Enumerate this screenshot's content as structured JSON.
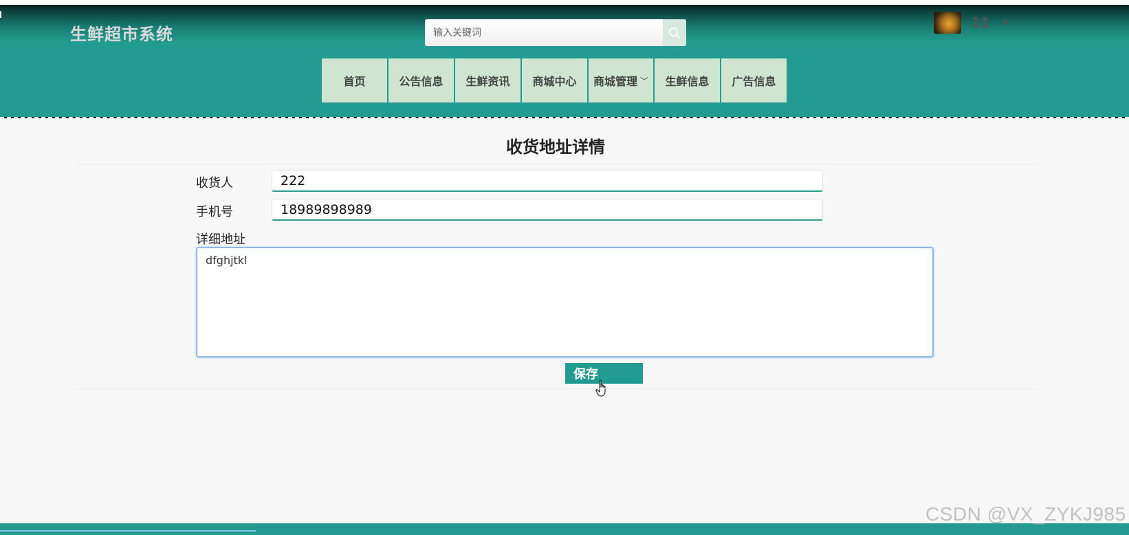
{
  "header": {
    "logo_text": "生鲜超市系统",
    "search": {
      "placeholder": "输入关键词",
      "value": ""
    },
    "user": {
      "name": "11"
    }
  },
  "nav": {
    "items": [
      {
        "label": "首页"
      },
      {
        "label": "公告信息"
      },
      {
        "label": "生鲜资讯"
      },
      {
        "label": "商城中心"
      },
      {
        "label": "商城管理",
        "has_dropdown": true
      },
      {
        "label": "生鲜信息"
      },
      {
        "label": "广告信息"
      }
    ]
  },
  "form": {
    "title": "收货地址详情",
    "receiver": {
      "label": "收货人",
      "value": "222"
    },
    "phone": {
      "label": "手机号",
      "value": "18989898989"
    },
    "address": {
      "label": "详细地址",
      "value": "dfghjtkl"
    },
    "save_label": "保存"
  },
  "watermark": "CSDN @VX_ZYKJ985",
  "colors": {
    "brand": "#229c90",
    "nav_item_bg": "#cfe5d2",
    "focus_border": "#8fb8ea"
  }
}
